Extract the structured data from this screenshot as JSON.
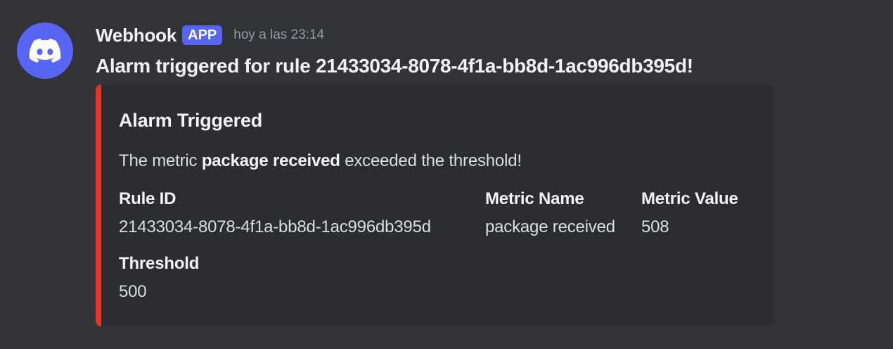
{
  "message": {
    "avatar_icon": "discord-logo-icon",
    "author": "Webhook",
    "badge": "APP",
    "timestamp": "hoy a las 23:14",
    "content": "Alarm triggered for rule 21433034-8078-4f1a-bb8d-1ac996db395d!"
  },
  "embed": {
    "accent_color": "#e53524",
    "title": "Alarm Triggered",
    "description": {
      "prefix": "The metric ",
      "bold": "package received",
      "suffix": " exceeded the threshold!"
    },
    "fields": {
      "rule_id": {
        "name": "Rule ID",
        "value": "21433034-8078-4f1a-bb8d-1ac996db395d"
      },
      "metric_name": {
        "name": "Metric Name",
        "value": "package received"
      },
      "metric_value": {
        "name": "Metric Value",
        "value": "508"
      },
      "threshold": {
        "name": "Threshold",
        "value": "500"
      }
    }
  },
  "colors": {
    "background": "#313338",
    "embed_background": "#2b2d31",
    "brand": "#5865f2"
  }
}
